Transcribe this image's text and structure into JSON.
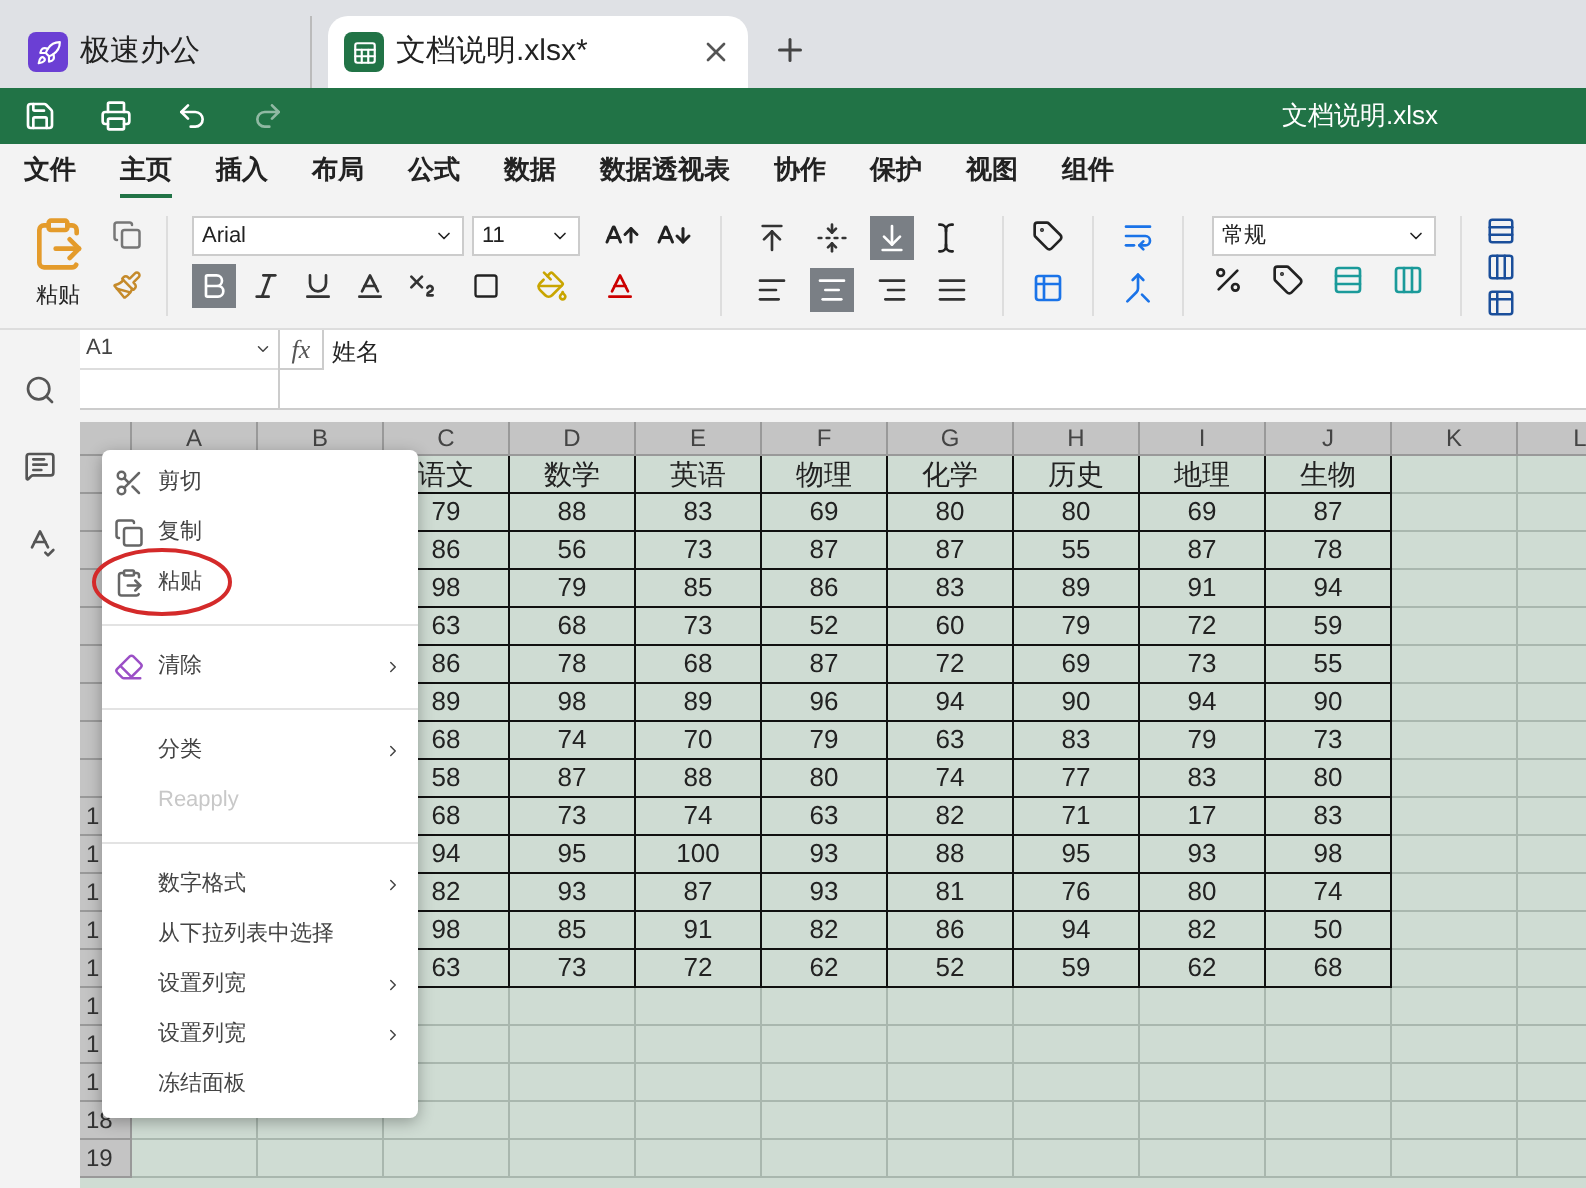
{
  "tabs": [
    {
      "kind": "app",
      "label": "极速办公",
      "selected": false
    },
    {
      "kind": "sheet",
      "label": "文档说明.xlsx*",
      "selected": true
    }
  ],
  "title_bar": {
    "title": "文档说明.xlsx"
  },
  "menu": [
    {
      "label": "文件",
      "selected": false
    },
    {
      "label": "主页",
      "selected": true
    },
    {
      "label": "插入",
      "selected": false
    },
    {
      "label": "布局",
      "selected": false
    },
    {
      "label": "公式",
      "selected": false
    },
    {
      "label": "数据",
      "selected": false
    },
    {
      "label": "数据透视表",
      "selected": false
    },
    {
      "label": "协作",
      "selected": false
    },
    {
      "label": "保护",
      "selected": false
    },
    {
      "label": "视图",
      "selected": false
    },
    {
      "label": "组件",
      "selected": false
    }
  ],
  "ribbon": {
    "paste_label": "粘贴",
    "font": "Arial",
    "font_size": "11",
    "number_format": "常规",
    "font_buttons": [
      {
        "kind": "bold",
        "selected": true
      },
      {
        "kind": "italic",
        "selected": false
      },
      {
        "kind": "underline",
        "selected": false
      },
      {
        "kind": "strike",
        "selected": false
      },
      {
        "kind": "subscript",
        "selected": false
      }
    ],
    "valign_buttons": [
      {
        "kind": "top",
        "selected": false
      },
      {
        "kind": "middle",
        "selected": false
      },
      {
        "kind": "bottom",
        "selected": true
      }
    ],
    "halign_buttons": [
      {
        "kind": "left",
        "selected": false
      },
      {
        "kind": "center",
        "selected": true
      },
      {
        "kind": "right",
        "selected": false
      },
      {
        "kind": "justify",
        "selected": false
      }
    ]
  },
  "formula_bar": {
    "cell_ref": "A1",
    "fx": "fx",
    "value": "姓名"
  },
  "sheet": {
    "columns": [
      "A",
      "B",
      "C",
      "D",
      "E",
      "F",
      "G",
      "H",
      "I",
      "J",
      "K",
      "L"
    ],
    "rows": [
      {
        "cells": [
          "语文",
          "数学",
          "英语",
          "物理",
          "化学",
          "历史",
          "地理",
          "生物"
        ]
      },
      {
        "cells": [
          "79",
          "88",
          "83",
          "69",
          "80",
          "80",
          "69",
          "87"
        ]
      },
      {
        "cells": [
          "86",
          "56",
          "73",
          "87",
          "87",
          "55",
          "87",
          "78"
        ]
      },
      {
        "cells": [
          "98",
          "79",
          "85",
          "86",
          "83",
          "89",
          "91",
          "94"
        ]
      },
      {
        "cells": [
          "63",
          "68",
          "73",
          "52",
          "60",
          "79",
          "72",
          "59"
        ]
      },
      {
        "cells": [
          "86",
          "78",
          "68",
          "87",
          "72",
          "69",
          "73",
          "55"
        ]
      },
      {
        "cells": [
          "89",
          "98",
          "89",
          "96",
          "94",
          "90",
          "94",
          "90"
        ]
      },
      {
        "cells": [
          "68",
          "74",
          "70",
          "79",
          "63",
          "83",
          "79",
          "73"
        ]
      },
      {
        "cells": [
          "58",
          "87",
          "88",
          "80",
          "74",
          "77",
          "83",
          "80"
        ]
      },
      {
        "header": "1",
        "cells": [
          "68",
          "73",
          "74",
          "63",
          "82",
          "71",
          "17",
          "83"
        ]
      },
      {
        "header": "1",
        "cells": [
          "94",
          "95",
          "100",
          "93",
          "88",
          "95",
          "93",
          "98"
        ]
      },
      {
        "header": "1",
        "cells": [
          "82",
          "93",
          "87",
          "93",
          "81",
          "76",
          "80",
          "74"
        ]
      },
      {
        "header": "1",
        "cells": [
          "98",
          "85",
          "91",
          "82",
          "86",
          "94",
          "82",
          "50"
        ]
      },
      {
        "header": "1",
        "cells": [
          "63",
          "73",
          "72",
          "62",
          "52",
          "59",
          "62",
          "68"
        ]
      },
      {
        "header": "1"
      },
      {
        "header": "1"
      },
      {
        "header": "1"
      },
      {
        "header": "18"
      },
      {
        "header": "19"
      }
    ]
  },
  "context_menu": {
    "items": [
      {
        "kind": "cut",
        "label": "剪切",
        "disabled": false,
        "submenu": false,
        "highlighted": false
      },
      {
        "kind": "copy",
        "label": "复制",
        "disabled": false,
        "submenu": false,
        "highlighted": false
      },
      {
        "kind": "paste",
        "label": "粘贴",
        "disabled": false,
        "submenu": false,
        "highlighted": true
      },
      {
        "kind": "separator"
      },
      {
        "kind": "clear",
        "label": "清除",
        "disabled": false,
        "submenu": true,
        "highlighted": false
      },
      {
        "kind": "separator"
      },
      {
        "kind": "item",
        "label": "分类",
        "disabled": false,
        "submenu": true,
        "highlighted": false
      },
      {
        "kind": "item",
        "label": "Reapply",
        "disabled": true,
        "submenu": false,
        "highlighted": false
      },
      {
        "kind": "separator"
      },
      {
        "kind": "item",
        "label": "数字格式",
        "disabled": false,
        "submenu": true,
        "highlighted": false
      },
      {
        "kind": "item",
        "label": "从下拉列表中选择",
        "disabled": false,
        "submenu": false,
        "highlighted": false
      },
      {
        "kind": "item",
        "label": "设置列宽",
        "disabled": false,
        "submenu": true,
        "highlighted": false
      },
      {
        "kind": "item",
        "label": "设置列宽",
        "disabled": false,
        "submenu": true,
        "highlighted": false
      },
      {
        "kind": "item",
        "label": "冻结面板",
        "disabled": false,
        "submenu": false,
        "highlighted": false
      }
    ]
  }
}
